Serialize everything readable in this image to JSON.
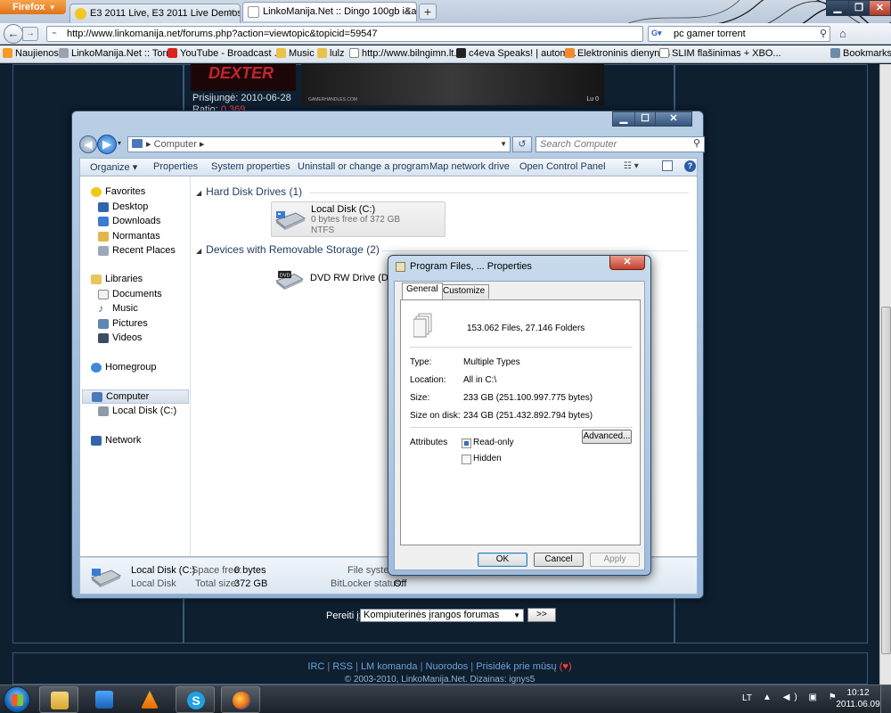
{
  "firefox": {
    "menu_button": "Firefox",
    "tabs": [
      {
        "title": "E3 2011 Live, E3 2011 Live Demos - G...",
        "favicon_color": "#f3c623"
      },
      {
        "title": "LinkoManija.Net :: Dingo 100gb i&a...",
        "favicon_color": "#ffffff"
      }
    ],
    "url": "http://www.linkomanija.net/forums.php?action=viewtopic&topicid=59547",
    "search_value": "pc gamer torrent",
    "search_engine_icon": "google-icon",
    "bookmarks": [
      {
        "label": "Naujienos",
        "icon": "rss-icon",
        "color": "#f59a23"
      },
      {
        "label": "LinkoManija.Net :: Torr...",
        "icon": "lm-icon",
        "color": "#9aa3ad"
      },
      {
        "label": "YouTube - Broadcast ...",
        "icon": "youtube-icon",
        "color": "#d9251d"
      },
      {
        "label": "Music",
        "icon": "folder-icon",
        "color": "#e8c34a"
      },
      {
        "label": "lulz",
        "icon": "folder-icon",
        "color": "#e8c34a"
      },
      {
        "label": "http://www.bilngimn.lt...",
        "icon": "page-icon",
        "color": "#ffffff"
      },
      {
        "label": "c4eva Speaks! | autom...",
        "icon": "c4-icon",
        "color": "#222222"
      },
      {
        "label": "Elektroninis dienynas",
        "icon": "ed-icon",
        "color": "#f2892b"
      },
      {
        "label": "SLIM flašinimas + XBO...",
        "icon": "page-icon",
        "color": "#ffffff"
      },
      {
        "label": "Bookmarks",
        "icon": "bookmarks-icon",
        "color": "#6f8aa8"
      }
    ]
  },
  "webpage": {
    "poster_text": "DEXTER",
    "member_joined": "Prisijungė: 2010-06-28",
    "ratio_label": "Ratio:",
    "ratio_value": "0.369",
    "sig_left": "GAMERHANDLES.COM",
    "sig_right": "Lu 0",
    "jump_label": "Pereiti į:",
    "jump_selected": "Kompiuterinės įrangos forumas",
    "jump_button": ">>",
    "footer_links": [
      "IRC",
      "RSS",
      "LM komanda",
      "Nuorodos",
      "Prisidėk prie mūsų"
    ],
    "footer_badge": "(♥)",
    "footer_copy": "© 2003-2010, LinkoManija.Net. Dizainas: ignys5"
  },
  "explorer": {
    "address_segments": [
      "Computer"
    ],
    "search_placeholder": "Search Computer",
    "toolbar": [
      "Organize ▾",
      "Properties",
      "System properties",
      "Uninstall or change a program",
      "Map network drive",
      "Open Control Panel"
    ],
    "nav": {
      "favorites": "Favorites",
      "desktop": "Desktop",
      "downloads": "Downloads",
      "normantas": "Normantas",
      "recent": "Recent Places",
      "libraries": "Libraries",
      "documents": "Documents",
      "music": "Music",
      "pictures": "Pictures",
      "videos": "Videos",
      "homegroup": "Homegroup",
      "computer": "Computer",
      "localdisk": "Local Disk (C:)",
      "network": "Network"
    },
    "groups": {
      "hdd": "Hard Disk Drives (1)",
      "removable": "Devices with Removable Storage (2)"
    },
    "local_disk": {
      "name": "Local Disk (C:)",
      "free": "0 bytes free of 372 GB",
      "fs": "NTFS"
    },
    "dvd": {
      "name": "DVD RW Drive (D:)"
    },
    "details": {
      "name": "Local Disk (C:)",
      "type": "Local Disk",
      "space_free_label": "Space free:",
      "space_free": "0 bytes",
      "total_label": "Total size:",
      "total": "372 GB",
      "fs_label": "File system",
      "bitlocker_label": "BitLocker status:",
      "bitlocker": "Off"
    }
  },
  "properties": {
    "title": "Program Files, ... Properties",
    "tabs": [
      "General",
      "Customize"
    ],
    "summary": "153.062 Files, 27.146 Folders",
    "rows": [
      {
        "label": "Type:",
        "value": "Multiple Types"
      },
      {
        "label": "Location:",
        "value": "All in C:\\"
      },
      {
        "label": "Size:",
        "value": "233 GB (251.100.997.775 bytes)"
      },
      {
        "label": "Size on disk:",
        "value": "234 GB (251.432.892.794 bytes)"
      }
    ],
    "attributes_label": "Attributes",
    "readonly": "Read-only",
    "hidden": "Hidden",
    "advanced": "Advanced...",
    "ok": "OK",
    "cancel": "Cancel",
    "apply": "Apply"
  },
  "taskbar": {
    "lang": "LT",
    "time": "10:12",
    "date": "2011.06.09",
    "apps": [
      "explorer-icon",
      "media-player-icon",
      "vlc-icon",
      "skype-icon",
      "firefox-icon"
    ]
  }
}
